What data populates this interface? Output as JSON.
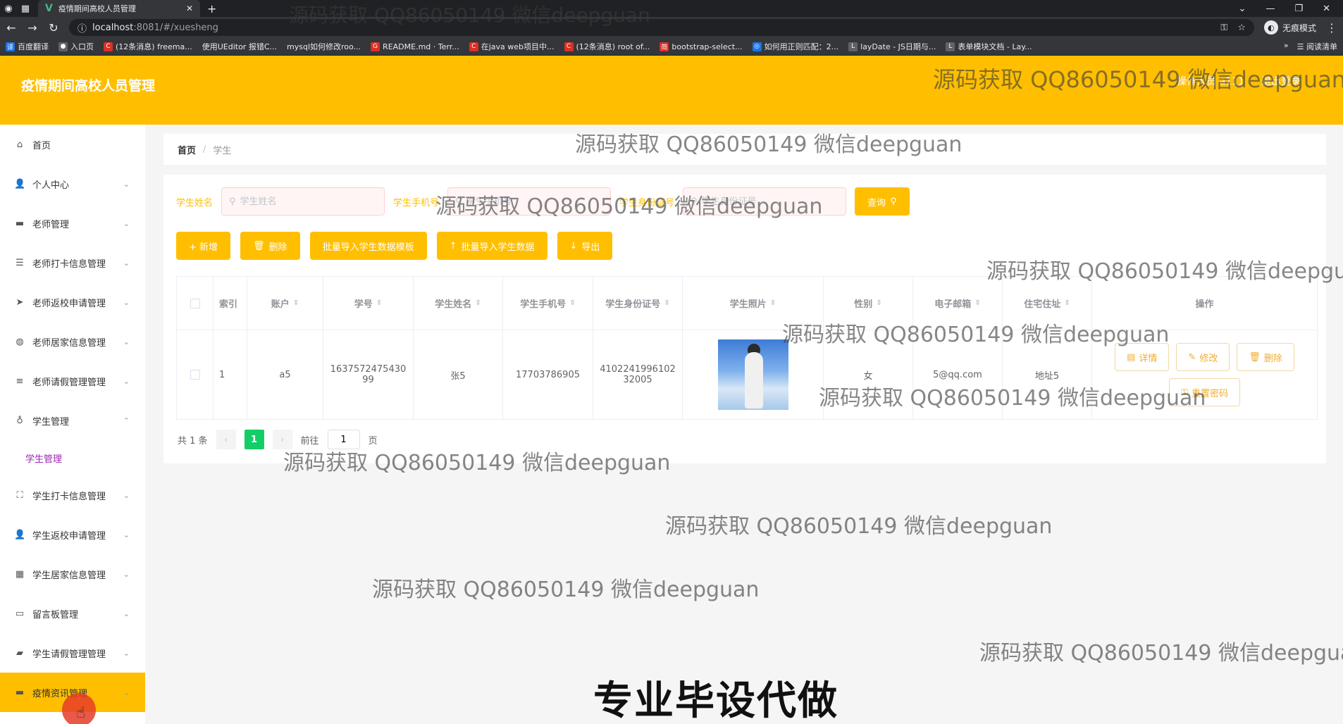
{
  "browser": {
    "tab_title": "疫情期间高校人员管理",
    "url_host": "localhost",
    "url_path": ":8081/#/xuesheng",
    "profile_label": "无痕模式",
    "bookmarks": [
      "百度翻译",
      "入口页",
      "(12条消息) freema...",
      "使用UEditor 报错C...",
      "mysql如何修改roo...",
      "README.md · Terr...",
      "在java web项目中...",
      "(12条消息) root of...",
      "bootstrap-select...",
      "如何用正则匹配：2...",
      "layDate - JS日期与...",
      "表单模块文档 - Lay..."
    ],
    "reading_list": "阅读清单"
  },
  "header": {
    "system_title": "疫情期间高校人员管理",
    "operator": "操作人员 a111",
    "logout": "退出登录"
  },
  "sidebar": {
    "items": [
      {
        "label": "首页",
        "icon": "home-icon"
      },
      {
        "label": "个人中心",
        "icon": "user-icon"
      },
      {
        "label": "老师管理",
        "icon": "monitor-icon"
      },
      {
        "label": "老师打卡信息管理",
        "icon": "sliders-icon"
      },
      {
        "label": "老师返校申请管理",
        "icon": "send-icon"
      },
      {
        "label": "老师居家信息管理",
        "icon": "globe-icon"
      },
      {
        "label": "老师请假管理管理",
        "icon": "list-icon"
      },
      {
        "label": "学生管理",
        "icon": "mic-icon"
      },
      {
        "label": "学生管理",
        "icon": ""
      },
      {
        "label": "学生打卡信息管理",
        "icon": "frame-icon"
      },
      {
        "label": "学生返校申请管理",
        "icon": "user-icon"
      },
      {
        "label": "学生居家信息管理",
        "icon": "grid-icon"
      },
      {
        "label": "留言板管理",
        "icon": "card-icon"
      },
      {
        "label": "学生请假管理管理",
        "icon": "bag-icon"
      },
      {
        "label": "疫情资讯管理",
        "icon": "screen-icon"
      }
    ]
  },
  "breadcrumb": {
    "home": "首页",
    "current": "学生"
  },
  "search": {
    "name_label": "学生姓名",
    "name_placeholder": "学生姓名",
    "phone_label": "学生手机号",
    "phone_placeholder": "学生手机号",
    "id_label": "学生身份证号",
    "id_placeholder": "学生身份证号",
    "query": "查询"
  },
  "actions": {
    "add": "+ 新增",
    "delete": "删除",
    "import_template": "批量导入学生数据模板",
    "import_data": "批量导入学生数据",
    "export": "导出"
  },
  "table": {
    "headers": [
      "索引",
      "账户",
      "学号",
      "学生姓名",
      "学生手机号",
      "学生身份证号",
      "学生照片",
      "性别",
      "电子邮箱",
      "住宅住址",
      "操作"
    ],
    "rows": [
      {
        "index": "1",
        "account": "a5",
        "student_no": "163757247543099",
        "name": "张5",
        "phone": "17703786905",
        "id_card": "410224199610232005",
        "gender": "女",
        "email": "5@qq.com",
        "address": "地址5"
      }
    ],
    "row_actions": {
      "detail": "详情",
      "edit": "修改",
      "delete": "删除",
      "reset_pwd": "重置密码"
    }
  },
  "pager": {
    "total": "共 1 条",
    "current": "1",
    "goto": "前往",
    "page_value": "1",
    "page_unit": "页"
  },
  "watermark": "源码获取 QQ86050149 微信deepguan",
  "bottom_banner": "专业毕设代做",
  "colors": {
    "accent": "#ffbf00",
    "pager_active": "#13ce66"
  }
}
